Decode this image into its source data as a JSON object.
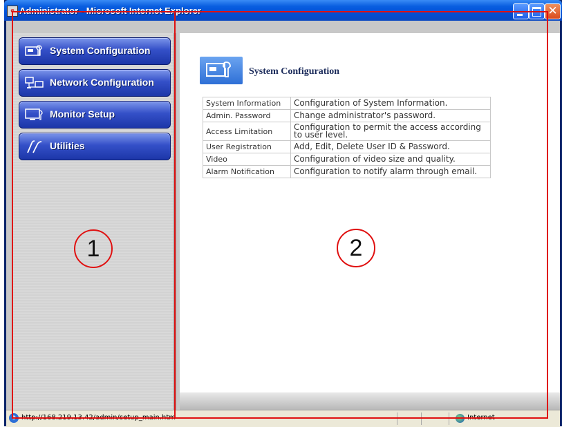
{
  "window": {
    "title": "Administrator - Microsoft Internet Explorer",
    "close_glyph": "✕"
  },
  "sidebar": {
    "items": [
      {
        "label": "System Configuration",
        "icon": "system-config-icon"
      },
      {
        "label": "Network Configuration",
        "icon": "network-config-icon"
      },
      {
        "label": "Monitor Setup",
        "icon": "monitor-icon"
      },
      {
        "label": "Utilities",
        "icon": "utilities-icon"
      }
    ]
  },
  "content": {
    "heading": "System Configuration",
    "table": [
      {
        "item": "System Information",
        "desc": "Configuration of System Information."
      },
      {
        "item": "Admin. Password",
        "desc": "Change administrator's password."
      },
      {
        "item": "Access Limitation",
        "desc": "Configuration to permit the access according to user level."
      },
      {
        "item": "User Registration",
        "desc": "Add, Edit, Delete User ID & Password."
      },
      {
        "item": "Video",
        "desc": "Configuration of video size and quality."
      },
      {
        "item": "Alarm Notification",
        "desc": "Configuration to notify alarm through email."
      }
    ]
  },
  "statusbar": {
    "url": "http://168.219.13.42/admin/setup_main.htm",
    "zone": "Internet"
  },
  "callouts": {
    "one": "1",
    "two": "2"
  },
  "colors": {
    "annotation": "#e01010",
    "menu_button": "#3450c8",
    "titlebar": "#0050d8"
  }
}
